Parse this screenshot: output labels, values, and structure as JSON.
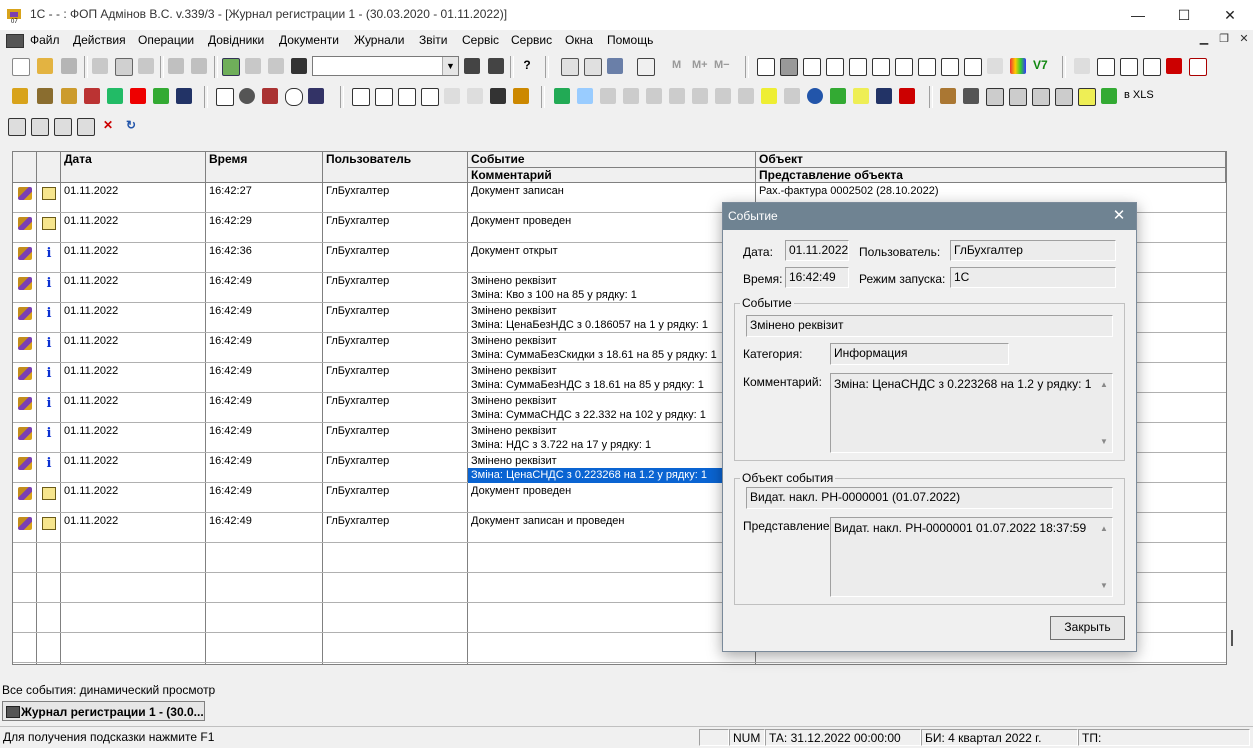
{
  "window": {
    "title": "1С - - : ФОП Адмінов В.С. v.339/3 - [Журнал регистрации 1 - (30.03.2020 - 01.11.2022)]",
    "minimize": "—",
    "maximize": "☐",
    "close": "✕"
  },
  "menu": {
    "items": [
      "Файл",
      "Действия",
      "Операции",
      "Довідники",
      "Документи",
      "Журнали",
      "Звіти",
      "Сервіс",
      "Сервис",
      "Окна",
      "Помощь"
    ],
    "mdi_min": "▁",
    "mdi_restore": "❐",
    "mdi_close": "✕"
  },
  "toolbar": {
    "text_m": "M",
    "text_mplus": "M+",
    "text_mminus": "M−",
    "text_v7": "V7",
    "to_xls": "в XLS"
  },
  "grid": {
    "headers": {
      "date": "Дата",
      "time": "Время",
      "user": "Пользователь",
      "event": "Событие",
      "comment": "Комментарий",
      "object": "Объект",
      "object_repr": "Представление объекта"
    },
    "rows": [
      {
        "icon": "doc",
        "date": "01.11.2022",
        "time": "16:42:27",
        "user": "ГлБухгалтер",
        "event": "Документ записан",
        "comment": "",
        "object": "Рах.-фактура 0002502 (28.10.2022)"
      },
      {
        "icon": "doc",
        "date": "01.11.2022",
        "time": "16:42:29",
        "user": "ГлБухгалтер",
        "event": "Документ проведен",
        "comment": "",
        "object": ""
      },
      {
        "icon": "info",
        "date": "01.11.2022",
        "time": "16:42:36",
        "user": "ГлБухгалтер",
        "event": "Документ открыт",
        "comment": "",
        "object": ""
      },
      {
        "icon": "info",
        "date": "01.11.2022",
        "time": "16:42:49",
        "user": "ГлБухгалтер",
        "event": "Змінено реквізит",
        "comment": "Зміна: Кво з 100 на 85 у рядку: 1",
        "object": ""
      },
      {
        "icon": "info",
        "date": "01.11.2022",
        "time": "16:42:49",
        "user": "ГлБухгалтер",
        "event": "Змінено реквізит",
        "comment": "Зміна: ЦенаБезНДС з 0.186057 на 1 у рядку: 1",
        "object": ""
      },
      {
        "icon": "info",
        "date": "01.11.2022",
        "time": "16:42:49",
        "user": "ГлБухгалтер",
        "event": "Змінено реквізит",
        "comment": "Зміна: СуммаБезСкидки з 18.61 на 85 у рядку: 1",
        "object": ""
      },
      {
        "icon": "info",
        "date": "01.11.2022",
        "time": "16:42:49",
        "user": "ГлБухгалтер",
        "event": "Змінено реквізит",
        "comment": "Зміна: СуммаБезНДС з 18.61 на 85 у рядку: 1",
        "object": ""
      },
      {
        "icon": "info",
        "date": "01.11.2022",
        "time": "16:42:49",
        "user": "ГлБухгалтер",
        "event": "Змінено реквізит",
        "comment": "Зміна: СуммаСНДС з 22.332 на 102 у рядку: 1",
        "object": ""
      },
      {
        "icon": "info",
        "date": "01.11.2022",
        "time": "16:42:49",
        "user": "ГлБухгалтер",
        "event": "Змінено реквізит",
        "comment": "Зміна: НДС з 3.722 на 17 у рядку: 1",
        "object": ""
      },
      {
        "icon": "info",
        "date": "01.11.2022",
        "time": "16:42:49",
        "user": "ГлБухгалтер",
        "event": "Змінено реквізит",
        "comment": "Зміна: ЦенаСНДС з 0.223268 на 1.2 у рядку: 1",
        "object": "",
        "selected": true
      },
      {
        "icon": "doc",
        "date": "01.11.2022",
        "time": "16:42:49",
        "user": "ГлБухгалтер",
        "event": "Документ проведен",
        "comment": "",
        "object": ""
      },
      {
        "icon": "doc",
        "date": "01.11.2022",
        "time": "16:42:49",
        "user": "ГлБухгалтер",
        "event": "Документ записан и проведен",
        "comment": "",
        "object": ""
      }
    ]
  },
  "dialog": {
    "title": "Событие",
    "close": "✕",
    "date_label": "Дата:",
    "date_value": "01.11.2022",
    "user_label": "Пользователь:",
    "user_value": "ГлБухгалтер",
    "time_label": "Время:",
    "time_value": "16:42:49",
    "mode_label": "Режим запуска:",
    "mode_value": "1С",
    "event_group": "Событие",
    "event_value": "Змінено реквізит",
    "category_label": "Категория:",
    "category_value": "Информация",
    "comment_label": "Комментарий:",
    "comment_value": "Зміна: ЦенаСНДС з 0.223268 на 1.2 у рядку: 1",
    "object_group": "Объект события",
    "object_value": "Видат. накл. РН-0000001 (01.07.2022)",
    "repr_label": "Представление:",
    "repr_value": "Видат. накл. РН-0000001 01.07.2022 18:37:59",
    "close_button": "Закрыть"
  },
  "status": {
    "mode_line": "Все события: динамический просмотр",
    "task_button": "Журнал регистрации 1 - (30.0...",
    "hint": "Для получения подсказки нажмите F1",
    "num": "NUM",
    "ta": "ТА: 31.12.2022  00:00:00",
    "bi": "БИ: 4 квартал 2022 г.",
    "tp": "ТП:"
  }
}
